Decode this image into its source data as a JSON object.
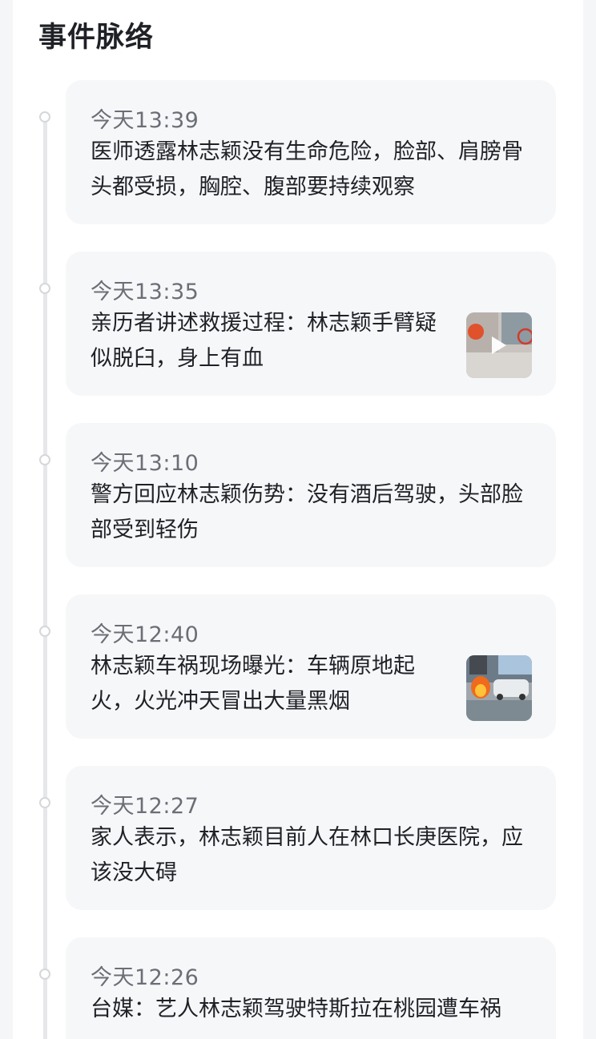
{
  "section": {
    "title": "事件脉络"
  },
  "events": [
    {
      "time": "今天13:39",
      "text": "医师透露林志颖没有生命危险，脸部、肩膀骨头都受损，胸腔、腹部要持续观察"
    },
    {
      "time": "今天13:35",
      "text": "亲历者讲述救援过程：林志颖手臂疑似脱臼，身上有血",
      "thumbnail_icon": "video-play-icon"
    },
    {
      "time": "今天13:10",
      "text": "警方回应林志颖伤势：没有酒后驾驶，头部脸部受到轻伤"
    },
    {
      "time": "今天12:40",
      "text": "林志颖车祸现场曝光：车辆原地起火，火光冲天冒出大量黑烟",
      "thumbnail_icon": "fire-photo-icon"
    },
    {
      "time": "今天12:27",
      "text": "家人表示，林志颖目前人在林口长庚医院，应该没大碍"
    },
    {
      "time": "今天12:26",
      "text": "台媒：艺人林志颖驾驶特斯拉在桃园遭车祸"
    }
  ],
  "colors": {
    "card_bg": "#f6f7f9",
    "time_text": "#6b6e75",
    "headline_text": "#1f2126",
    "timeline": "#e6e7ea"
  }
}
